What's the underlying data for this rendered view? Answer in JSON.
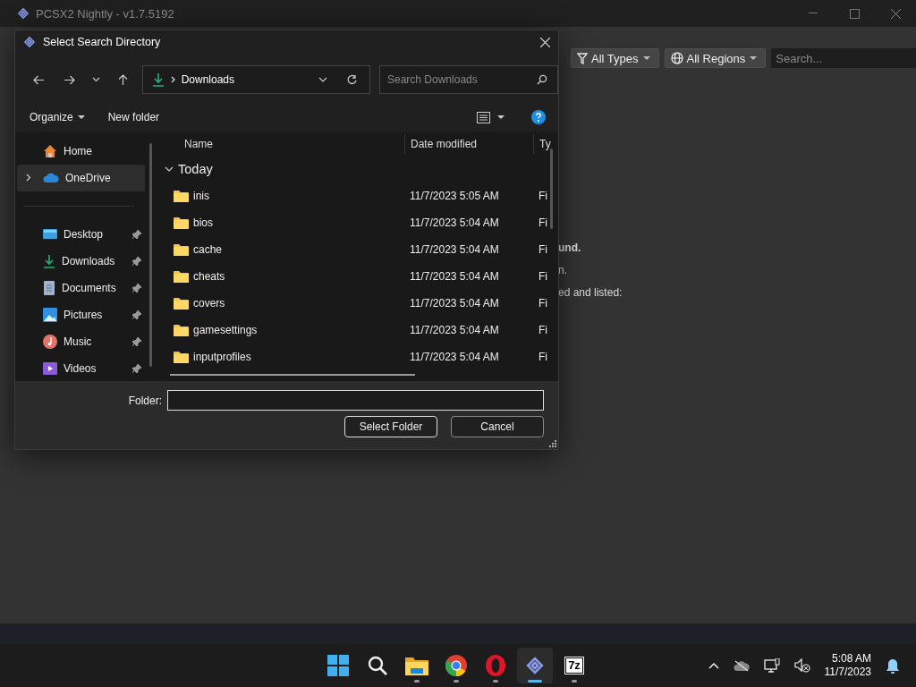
{
  "main_window": {
    "title": "PCSX2 Nightly - v1.7.5192",
    "filters": [
      {
        "kind": "type",
        "label": "All Types"
      },
      {
        "kind": "region",
        "label": "All Regions"
      }
    ],
    "search": {
      "placeholder": "Search..."
    },
    "message_fragments": [
      {
        "kind": "heading",
        "text": "und."
      },
      {
        "kind": "text",
        "text": "n."
      },
      {
        "kind": "text",
        "text": "ed and listed:"
      }
    ]
  },
  "dialog": {
    "title": "Select Search Directory",
    "path": "Downloads",
    "search": {
      "placeholder": "Search Downloads"
    },
    "commands": [
      "Organize",
      "New folder"
    ],
    "sidebar": [
      {
        "kind": "home",
        "label": "Home",
        "selected": false,
        "pinned": false
      },
      {
        "kind": "onedrive",
        "label": "OneDrive",
        "selected": true,
        "pinned": false
      },
      {
        "kind": "desktop",
        "label": "Desktop",
        "selected": false,
        "pinned": true
      },
      {
        "kind": "downloads",
        "label": "Downloads",
        "selected": false,
        "pinned": true
      },
      {
        "kind": "documents",
        "label": "Documents",
        "selected": false,
        "pinned": true
      },
      {
        "kind": "pictures",
        "label": "Pictures",
        "selected": false,
        "pinned": true
      },
      {
        "kind": "music",
        "label": "Music",
        "selected": false,
        "pinned": true
      },
      {
        "kind": "videos",
        "label": "Videos",
        "selected": false,
        "pinned": true
      }
    ],
    "columns": [
      "Name",
      "Date modified",
      "Ty"
    ],
    "group": "Today",
    "rows": [
      {
        "name": "inis",
        "date": "11/7/2023 5:05 AM",
        "type": "Fi"
      },
      {
        "name": "bios",
        "date": "11/7/2023 5:04 AM",
        "type": "Fi"
      },
      {
        "name": "cache",
        "date": "11/7/2023 5:04 AM",
        "type": "Fi"
      },
      {
        "name": "cheats",
        "date": "11/7/2023 5:04 AM",
        "type": "Fi"
      },
      {
        "name": "covers",
        "date": "11/7/2023 5:04 AM",
        "type": "Fi"
      },
      {
        "name": "gamesettings",
        "date": "11/7/2023 5:04 AM",
        "type": "Fi"
      },
      {
        "name": "inputprofiles",
        "date": "11/7/2023 5:04 AM",
        "type": "Fi"
      }
    ],
    "folder_label": "Folder:",
    "buttons": [
      "Select Folder",
      "Cancel"
    ]
  },
  "taskbar": {
    "apps": [
      {
        "kind": "start",
        "running": false,
        "selected": false
      },
      {
        "kind": "search",
        "running": false,
        "selected": false
      },
      {
        "kind": "files",
        "running": true,
        "selected": false
      },
      {
        "kind": "browser",
        "running": true,
        "selected": false
      },
      {
        "kind": "opera",
        "running": true,
        "selected": false
      },
      {
        "kind": "pcsx2",
        "running": true,
        "selected": true
      },
      {
        "kind": "archiver",
        "label": "7z",
        "running": true,
        "selected": false
      }
    ],
    "time": "5:08 AM",
    "date": "11/7/2023"
  }
}
